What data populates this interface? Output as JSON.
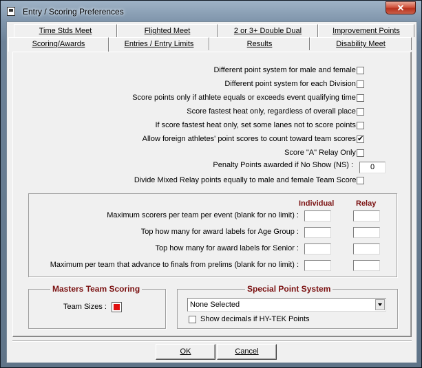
{
  "window": {
    "title": "Entry / Scoring Preferences",
    "close_label": "✕"
  },
  "tabs_back": [
    {
      "label": "Time Stds Meet"
    },
    {
      "label": "Flighted Meet"
    },
    {
      "label": "2 or 3+ Double Dual"
    },
    {
      "label": "Improvement Points"
    }
  ],
  "tabs_front": [
    {
      "label": "Scoring/Awards",
      "active": true
    },
    {
      "label": "Entries / Entry Limits"
    },
    {
      "label": "Results"
    },
    {
      "label": "Disability Meet"
    }
  ],
  "options": [
    {
      "label": "Different point system for male and female :",
      "checked": false
    },
    {
      "label": "Different point system for each Division :",
      "checked": false
    },
    {
      "label": "Score points only if athlete equals or exceeds event qualifying time :",
      "checked": false
    },
    {
      "label": "Score fastest heat only, regardless of overall place :",
      "checked": false
    },
    {
      "label": "If score fastest heat only, set some lanes not to score points :",
      "checked": false
    },
    {
      "label": "Allow foreign athletes' point scores to count toward team scores :",
      "checked": true
    },
    {
      "label": "Score \"A\" Relay Only :",
      "checked": false
    }
  ],
  "penalty": {
    "label": "Penalty Points awarded if No Show (NS) :",
    "value": "0"
  },
  "divide_mixed": {
    "label": "Divide Mixed Relay points equally to male and female Team Scores",
    "checked": false
  },
  "limits": {
    "col_individual": "Individual",
    "col_relay": "Relay",
    "rows": [
      {
        "label": "Maximum scorers per team per event (blank for no limit) :",
        "individual": "",
        "relay": ""
      },
      {
        "label": "Top how many for award labels for Age Group :",
        "individual": "",
        "relay": ""
      },
      {
        "label": "Top how many for award labels for Senior :",
        "individual": "",
        "relay": ""
      },
      {
        "label": "Maximum per team that advance to finals from prelims (blank for no limit) :",
        "individual": "",
        "relay": ""
      }
    ]
  },
  "masters": {
    "title": "Masters Team Scoring",
    "team_sizes_label": "Team Sizes :",
    "swatch_color": "#e01010"
  },
  "special": {
    "title": "Special Point System",
    "selected": "None Selected",
    "show_decimals_label": "Show decimals if HY-TEK Points",
    "show_decimals_checked": false
  },
  "buttons": {
    "ok": "OK",
    "cancel": "Cancel"
  },
  "colors": {
    "group_title": "#7a1010",
    "dialog_bg": "#f0f0f0"
  }
}
